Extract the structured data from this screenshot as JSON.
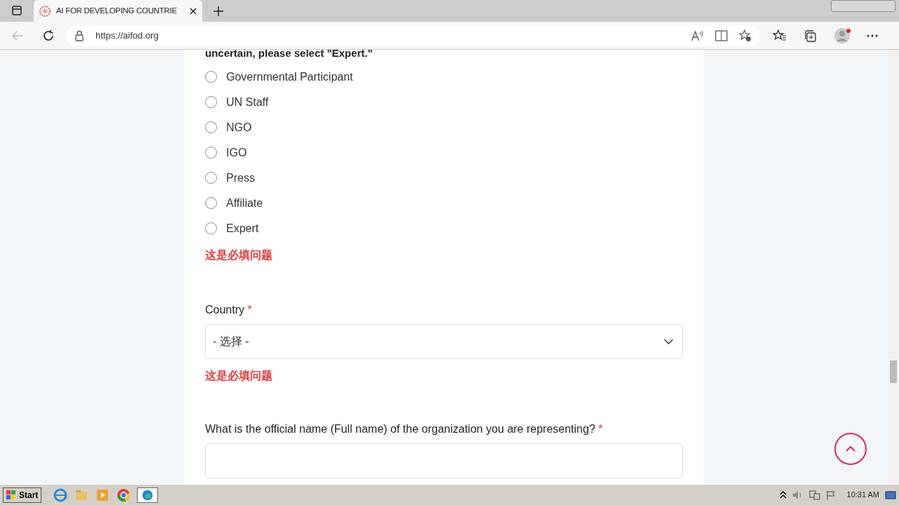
{
  "browser": {
    "tab_title": "AI FOR DEVELOPING COUNTRIE",
    "url": "https://aifod.org"
  },
  "form": {
    "question_tail": "uncertain, please select \"Expert.\"",
    "options": [
      {
        "label": "Governmental Participant",
        "selected": false
      },
      {
        "label": "UN Staff",
        "selected": false
      },
      {
        "label": "NGO",
        "selected": false
      },
      {
        "label": "IGO",
        "selected": false
      },
      {
        "label": "Press",
        "selected": false
      },
      {
        "label": "Affiliate",
        "selected": false
      },
      {
        "label": "Expert",
        "selected": false
      }
    ],
    "options_error": "这是必填问题",
    "country": {
      "label": "Country",
      "required_mark": "*",
      "placeholder": "- 选择 -",
      "error": "这是必填问题"
    },
    "organization": {
      "label": "What is the official name (Full name) of the organization you are representing?",
      "required_mark": "*"
    }
  },
  "taskbar": {
    "start": "Start",
    "clock": "10:31 AM"
  }
}
